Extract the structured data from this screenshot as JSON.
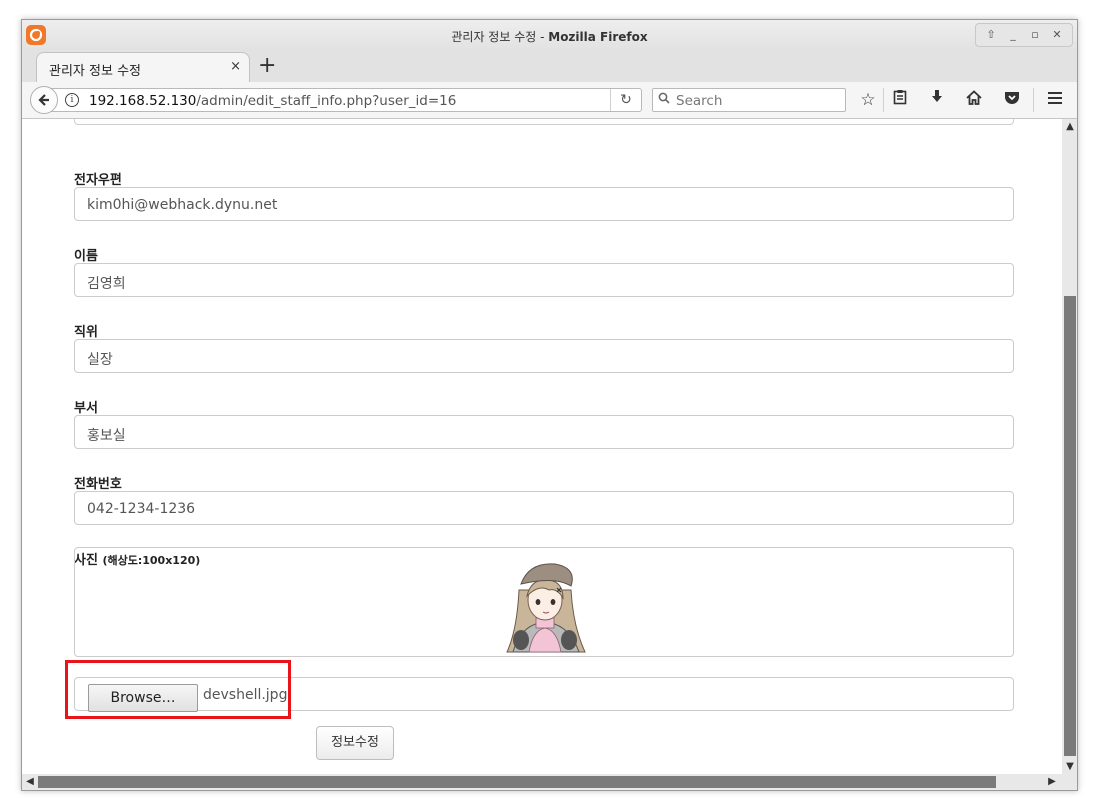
{
  "window": {
    "title_prefix": "관리자 정보 수정 - ",
    "title_app": "Mozilla Firefox"
  },
  "tab": {
    "label": "관리자 정보 수정",
    "close": "×",
    "new_tab": "+"
  },
  "nav": {
    "url_host": "192.168.52.130",
    "url_path": "/admin/edit_staff_info.php?user_id=16",
    "search_placeholder": "Search"
  },
  "icons": {
    "back": "back-arrow-icon",
    "info": "info-icon",
    "reload": "reload-icon",
    "search": "search-icon",
    "bookmark": "star-icon",
    "reader": "clipboard-icon",
    "downloads": "download-icon",
    "home": "home-icon",
    "pocket": "pocket-icon",
    "menu": "hamburger-menu-icon"
  },
  "form": {
    "email": {
      "label": "전자우편",
      "value": "kim0hi@webhack.dynu.net"
    },
    "name": {
      "label": "이름",
      "value": "김영희"
    },
    "position": {
      "label": "직위",
      "value": "실장"
    },
    "department": {
      "label": "부서",
      "value": "홍보실"
    },
    "phone": {
      "label": "전화번호",
      "value": "042-1234-1236"
    },
    "photo": {
      "label": "사진",
      "hint": "(해상도:100x120)"
    },
    "file": {
      "browse_label": "Browse…",
      "file_name": "devshell.jpg"
    },
    "submit_label": "정보수정"
  },
  "colors": {
    "highlight": "#e8141a",
    "firefox_orange": "#f07828",
    "scrollbar_thumb": "#7a7a7a"
  }
}
